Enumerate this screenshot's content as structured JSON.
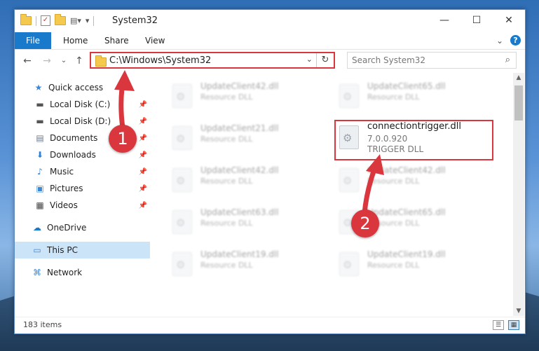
{
  "window": {
    "title": "System32",
    "controls": {
      "minimize": "—",
      "maximize": "☐",
      "close": "✕"
    }
  },
  "ribbon": {
    "tabs": [
      "File",
      "Home",
      "Share",
      "View"
    ],
    "expand_glyph": "⌄",
    "help_glyph": "?"
  },
  "navigation": {
    "back": "←",
    "forward": "→",
    "recent": "⌄",
    "up": "↑",
    "address": "C:\\Windows\\System32",
    "address_dropdown": "⌄",
    "refresh": "↻",
    "search_placeholder": "Search System32",
    "search_glyph": "⌕"
  },
  "sidebar": {
    "items": [
      {
        "label": "Quick access",
        "icon": "★"
      },
      {
        "label": "Local Disk (C:)",
        "icon": "▬"
      },
      {
        "label": "Local Disk (D:)",
        "icon": "▬"
      },
      {
        "label": "Documents",
        "icon": "▤"
      },
      {
        "label": "Downloads",
        "icon": "⬇"
      },
      {
        "label": "Music",
        "icon": "♪"
      },
      {
        "label": "Pictures",
        "icon": "▣"
      },
      {
        "label": "Videos",
        "icon": "▦"
      },
      {
        "label": "OneDrive",
        "icon": "☁"
      },
      {
        "label": "This PC",
        "icon": "▭"
      },
      {
        "label": "Network",
        "icon": "⌘"
      }
    ],
    "pin_glyph": "📌"
  },
  "files": [
    {
      "name": "UpdateClient42.dll",
      "type": "Resource DLL"
    },
    {
      "name": "UpdateClient65.dll",
      "type": "Resource DLL"
    },
    {
      "name": "UpdateClient21.dll",
      "type": "Resource DLL"
    },
    {
      "name": "connectiontrigger.dll",
      "version": "7.0.0.920",
      "type": "TRIGGER DLL"
    },
    {
      "name": "UpdateClient42.dll",
      "type": "Resource DLL"
    },
    {
      "name": "UpdateClient42.dll",
      "type": "Resource DLL"
    },
    {
      "name": "UpdateClient63.dll",
      "type": "Resource DLL"
    },
    {
      "name": "UpdateClient65.dll",
      "type": "Resource DLL"
    },
    {
      "name": "UpdateClient19.dll",
      "type": "Resource DLL"
    },
    {
      "name": "UpdateClient19.dll",
      "type": "Resource DLL"
    }
  ],
  "status": {
    "items": "183 items",
    "view_details": "☰",
    "view_icons": "▦"
  },
  "annotations": {
    "step1": "1",
    "step2": "2",
    "color": "#d9363e"
  },
  "colors": {
    "accent": "#1979ca",
    "selection": "#cce4f7"
  }
}
